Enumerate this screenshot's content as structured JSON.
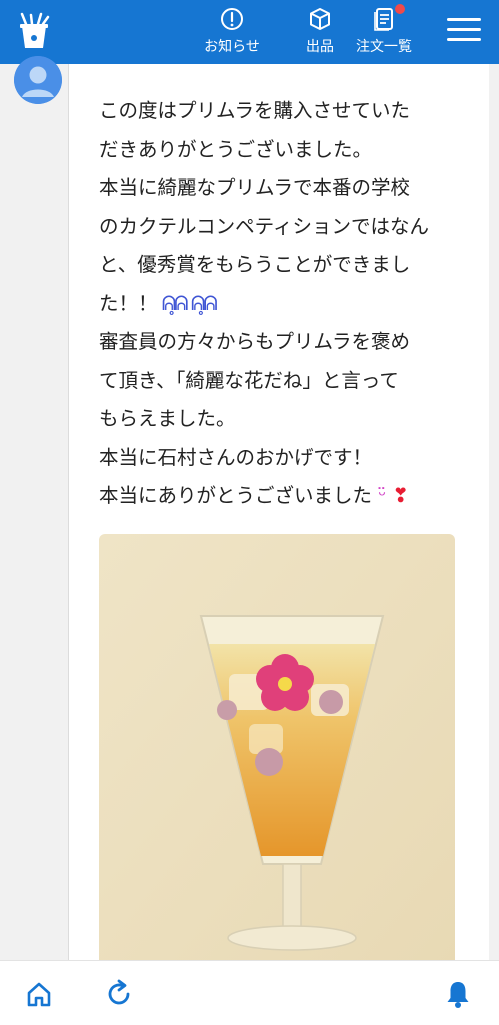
{
  "header": {
    "nav": [
      {
        "label": "お知らせ",
        "icon": "info-icon"
      },
      {
        "label": "出品",
        "icon": "box-icon"
      },
      {
        "label": "注文一覧",
        "icon": "document-icon",
        "badge": true
      }
    ],
    "menu_icon": "hamburger-menu-icon",
    "logo_icon": "app-logo-icon"
  },
  "post": {
    "avatar_icon": "user-avatar-icon",
    "lines": [
      "この度はプリムラを購入させていた",
      "だきありがとうございました。",
      "本当に綺麗なプリムラで本番の学校",
      "のカクテルコンペティションではなん",
      "と、優秀賞をもらうことができまし",
      "た！！",
      "審査員の方々からもプリムラを褒め",
      "て頂き、「綺麗な花だね」と言って",
      "もらえました。",
      "本当に石村さんのおかげです！",
      "本当にありがとうございました"
    ],
    "photo_icon": "cocktail-photo"
  },
  "bottom_nav": {
    "icons": [
      "home-icon",
      "refresh-icon",
      "bell-icon"
    ]
  },
  "colors": {
    "accent": "#1676d2",
    "badge": "#ef4a4a",
    "background": "#f1f1f1"
  }
}
